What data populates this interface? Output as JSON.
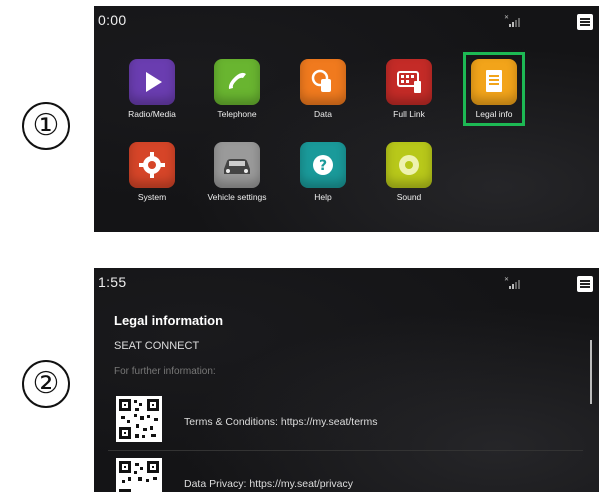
{
  "markers": [
    "①",
    "②"
  ],
  "screen1": {
    "time": "0:00",
    "apps": [
      {
        "label": "Radio/Media",
        "icon": "play-icon",
        "color": "#6a3db0"
      },
      {
        "label": "Telephone",
        "icon": "phone-icon",
        "color": "#69b530"
      },
      {
        "label": "Data",
        "icon": "fuel-icon",
        "color": "#f07a1e"
      },
      {
        "label": "Full Link",
        "icon": "grid-phone-icon",
        "color": "#c42b27"
      },
      {
        "label": "Legal info",
        "icon": "document-icon",
        "color": "#f2a41a",
        "highlighted": true
      },
      {
        "label": "System",
        "icon": "gear-icon",
        "color": "#d64528"
      },
      {
        "label": "Vehicle settings",
        "icon": "car-icon",
        "color": "#9a9a9a"
      },
      {
        "label": "Help",
        "icon": "question-icon",
        "color": "#1a9a9a"
      },
      {
        "label": "Sound",
        "icon": "speaker-icon",
        "color": "#b8c81a"
      }
    ]
  },
  "screen2": {
    "time": "1:55",
    "title": "Legal information",
    "subtitle": "SEAT CONNECT",
    "hint": "For further information:",
    "links": [
      {
        "text": "Terms & Conditions: https://my.seat/terms",
        "icon": "qr-code-icon"
      },
      {
        "text": "Data Privacy: https://my.seat/privacy",
        "icon": "qr-code-icon"
      }
    ]
  }
}
